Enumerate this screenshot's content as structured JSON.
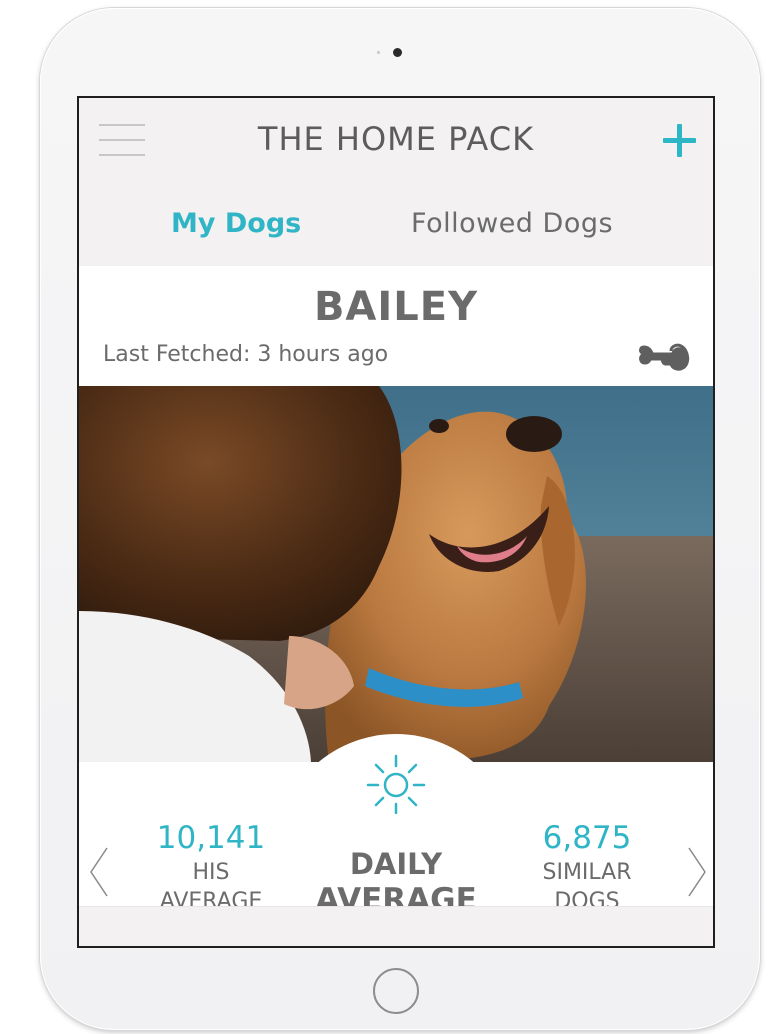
{
  "header": {
    "title": "THE HOME PACK",
    "menu_icon": "hamburger-menu-icon",
    "add_icon": "plus-icon"
  },
  "tabs": [
    {
      "label": "My Dogs",
      "active": true
    },
    {
      "label": "Followed Dogs",
      "active": false
    }
  ],
  "dog": {
    "name": "BAILEY",
    "last_fetched": "Last Fetched: 3 hours ago",
    "status_icon": "dog-bone-icon",
    "photo": "golden-retriever-photo"
  },
  "stats": {
    "center_icon": "sun-icon",
    "his_value": "10,141",
    "his_label_line1": "HIS",
    "his_label_line2": "AVERAGE",
    "center_label_line1": "DAILY",
    "center_label_line2": "AVERAGE",
    "similar_value": "6,875",
    "similar_label_line1": "SIMILAR",
    "similar_label_line2": "DOGS"
  },
  "colors": {
    "accent": "#2fb5c6",
    "text": "#6b6b6b",
    "header_bg": "#f3f1f1"
  }
}
